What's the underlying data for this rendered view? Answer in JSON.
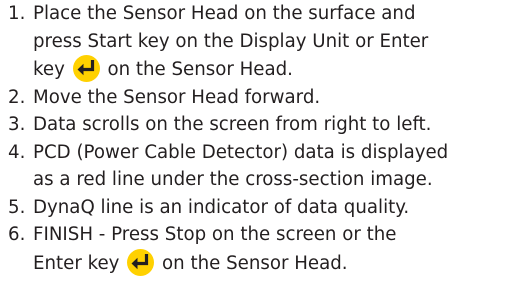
{
  "steps": [
    {
      "num": "1.",
      "line1": "Place the Sensor Head on the surface and",
      "line2": "press Start key on the Display Unit or Enter",
      "line3_before": "key",
      "line3_after": "on the Sensor Head."
    },
    {
      "num": "2.",
      "line1": "Move the Sensor Head forward."
    },
    {
      "num": "3.",
      "line1": "Data scrolls on the screen from right to left."
    },
    {
      "num": "4.",
      "line1": "PCD (Power Cable Detector) data is displayed",
      "line2": "as a red line under the cross-section image."
    },
    {
      "num": "5.",
      "line1": "DynaQ line is an indicator of data quality."
    },
    {
      "num": "6.",
      "line1": "FINISH - Press Stop on the screen or the",
      "line2_before": "Enter key",
      "line2_after": "on the Sensor Head."
    }
  ],
  "icons": {
    "enter_key": "enter-key-icon",
    "enter_key_color": "#ffd100"
  },
  "colors": {
    "text": "#231f20",
    "background": "#ffffff"
  }
}
